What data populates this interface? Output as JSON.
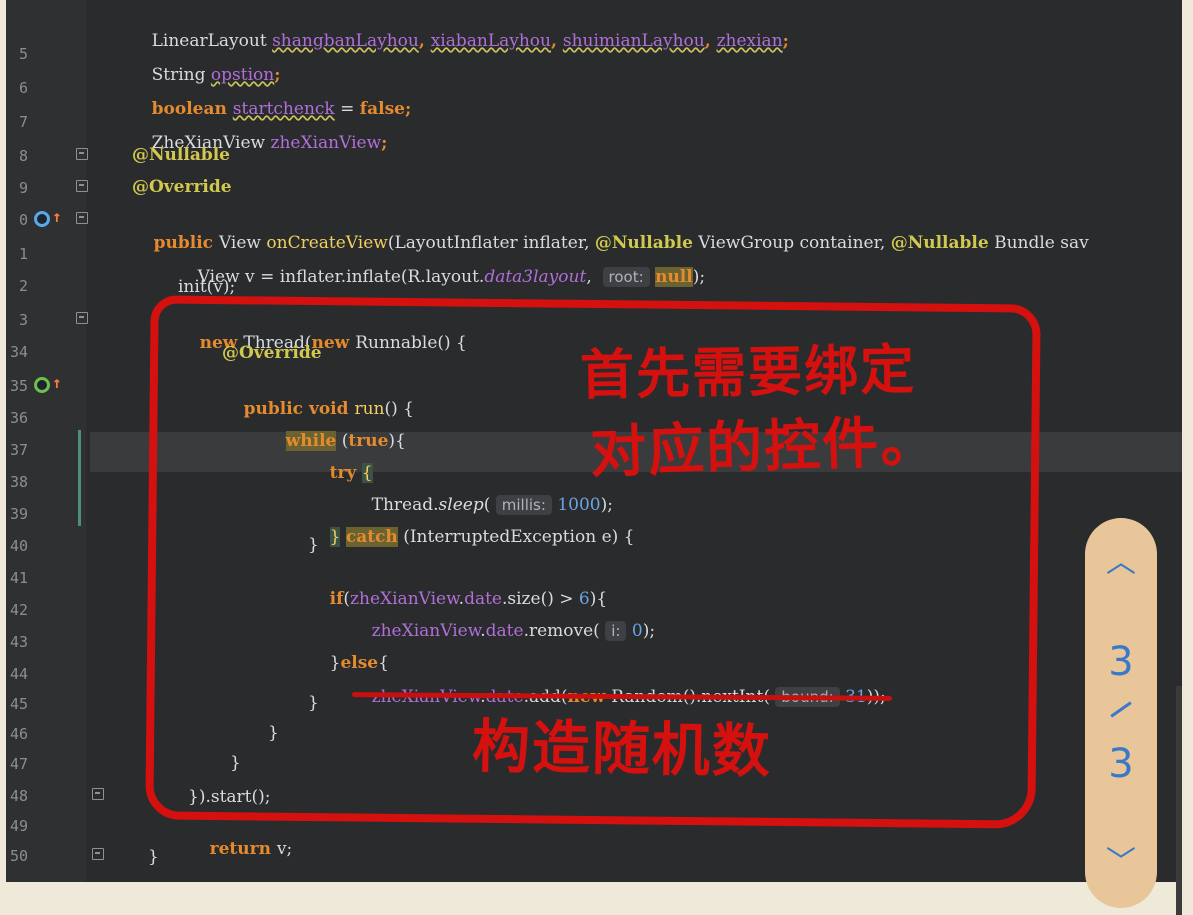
{
  "gutter": {
    "line_numbers": [
      "5",
      "",
      "6",
      "7",
      "8",
      "9",
      "0",
      "1",
      "2",
      "3",
      "4",
      "5",
      "6",
      "7",
      "8",
      "9",
      "0",
      "1",
      "2",
      "3",
      "4",
      "5",
      "6",
      "7",
      "8",
      "9",
      "0"
    ],
    "line_numbers_display": [
      "",
      "5",
      "6",
      "7",
      "8",
      "9",
      "0",
      "1",
      "2",
      "3",
      "34",
      "35",
      "36",
      "37",
      "38",
      "39",
      "40",
      "41",
      "42",
      "43",
      "44",
      "45",
      "46",
      "47",
      "48",
      "49",
      "50"
    ]
  },
  "code": {
    "l1": [
      "LinearLayout ",
      "shangbanLayhou",
      ", ",
      "xiabanLayhou",
      ", ",
      "shuimianLayhou",
      ", ",
      "zhexian",
      ";"
    ],
    "l2": [
      "String ",
      "opstion",
      ";"
    ],
    "l3": [
      "boolean ",
      "startchenck",
      " = ",
      "false",
      ";"
    ],
    "l4": [
      "ZheXianView ",
      "zheXianView",
      ";"
    ],
    "l5": "@Nullable",
    "l6": "@Override",
    "l7": [
      "public ",
      "View ",
      "onCreateView",
      "(LayoutInflater inflater, ",
      "@Nullable",
      " ViewGroup container, ",
      "@Nullable",
      " Bundle sav"
    ],
    "l8": [
      "View v = inflater.inflate(R.layout.",
      "data3layout",
      ",  ",
      "root:",
      " ",
      "null",
      ");"
    ],
    "l9": "init(v);",
    "l10": [
      "new ",
      "Thread(",
      "new ",
      "Runnable() {"
    ],
    "l11": "@Override",
    "l12": [
      "public ",
      "void ",
      "run",
      "() {"
    ],
    "l13": [
      "while",
      " (",
      "true",
      "){"
    ],
    "l14": [
      "try",
      " ",
      "{"
    ],
    "l15": [
      "Thread.",
      "sleep",
      "( ",
      "millis:",
      " ",
      "1000",
      ");"
    ],
    "l16": [
      "}",
      " ",
      "catch",
      " (InterruptedException e) {"
    ],
    "l17": "}",
    "l18": [
      "if",
      "(",
      "zheXianView",
      ".",
      "date",
      ".size() > ",
      "6",
      "){"
    ],
    "l19": [
      "zheXianView",
      ".",
      "date",
      ".remove( ",
      "i:",
      " ",
      "0",
      ");"
    ],
    "l20": [
      "}",
      "else",
      "{"
    ],
    "l21": [
      "zheXianView",
      ".",
      "date",
      ".add(",
      "new ",
      "Random().nextInt( ",
      "bound:",
      " ",
      "31",
      "));"
    ],
    "l22": "}",
    "l23": "}",
    "l24": "}",
    "l25": "}).start();",
    "l26": [
      "return ",
      "v;"
    ],
    "l27": "}"
  },
  "annotations": {
    "note1_line1": "首先需要绑定",
    "note1_line2": "对应的控件。",
    "note2": "构造随机数"
  },
  "pager": {
    "up_icon": "chevron-up-icon",
    "down_icon": "chevron-down-icon",
    "current": "3",
    "total": "3"
  },
  "colors": {
    "annotation_red": "#d4110e",
    "pager_bg": "#e8c69a",
    "pager_fg": "#3a78c8",
    "editor_bg": "#2a2b2d"
  }
}
